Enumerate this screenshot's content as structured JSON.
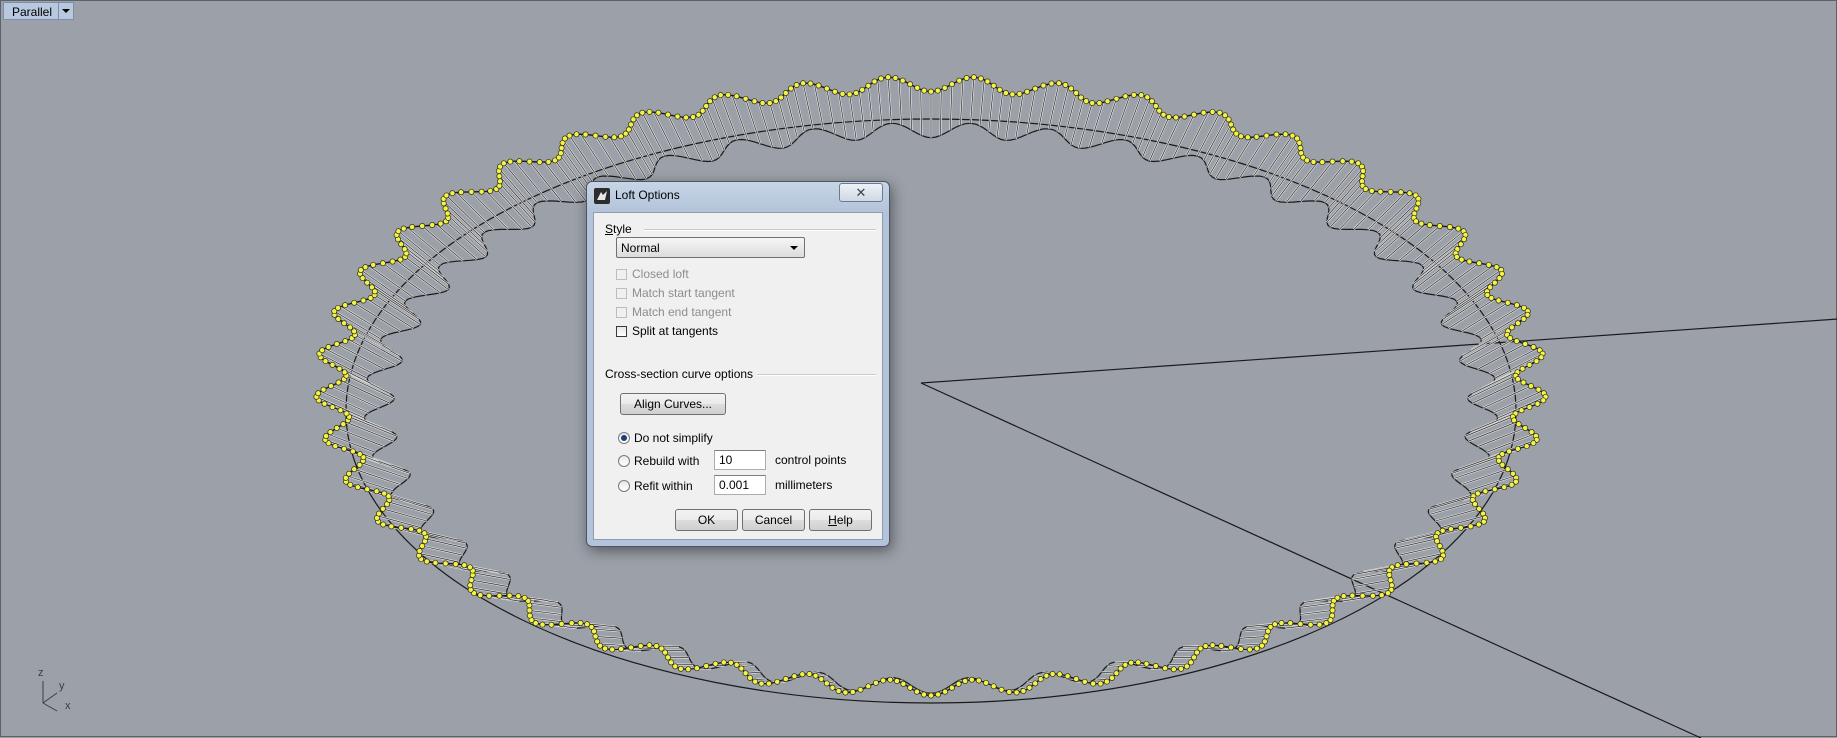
{
  "viewport": {
    "name_label": "Parallel",
    "axis_labels": {
      "z": "z",
      "y": "y",
      "x": "x"
    }
  },
  "scene": {
    "line_color": "#1a1a1a",
    "curve_highlight_color": "#f2f24a",
    "background_color": "#9ca1a9"
  },
  "dialog": {
    "title": "Loft Options",
    "close_glyph": "✕",
    "style_group_label": "Style",
    "style_value": "Normal",
    "checkboxes": {
      "closed_loft": "Closed loft",
      "match_start_tangent": "Match start tangent",
      "match_end_tangent": "Match end tangent",
      "split_at_tangents": "Split at tangents"
    },
    "cross_section_label": "Cross-section curve options",
    "align_curves_label": "Align Curves...",
    "radio": {
      "do_not_simplify": "Do not simplify",
      "rebuild_with": "Rebuild with",
      "refit_within": "Refit within",
      "selected": "do_not_simplify"
    },
    "rebuild_value": "10",
    "rebuild_unit": "control points",
    "refit_value": "0.001",
    "refit_unit": "millimeters",
    "buttons": {
      "ok": "OK",
      "cancel": "Cancel",
      "help": "Help"
    }
  }
}
